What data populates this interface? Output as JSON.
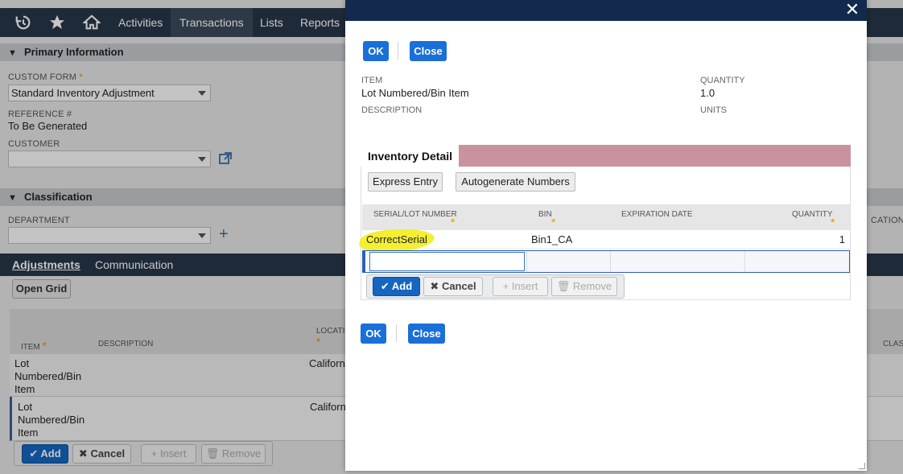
{
  "nav": {
    "items": [
      "Activities",
      "Transactions",
      "Lists",
      "Reports"
    ],
    "active": "Transactions"
  },
  "primary": {
    "title": "Primary Information",
    "custom_form_label": "CUSTOM FORM",
    "custom_form_value": "Standard Inventory Adjustment",
    "reference_label": "REFERENCE #",
    "reference_value": "To Be Generated",
    "customer_label": "CUSTOMER"
  },
  "classification": {
    "title": "Classification",
    "department_label": "DEPARTMENT",
    "right_label_fragment": "CATION"
  },
  "subtabs": [
    "Adjustments",
    "Communication"
  ],
  "bg_grid": {
    "open_grid_label": "Open Grid",
    "columns": [
      "ITEM",
      "DESCRIPTION",
      "LOCATI",
      "CLASS"
    ],
    "rows": [
      {
        "item": "Lot\nNumbered/Bin\nItem",
        "location": "Californi"
      },
      {
        "item": "Lot\nNumbered/Bin\nItem",
        "location": "Californ"
      }
    ],
    "buttons": {
      "add": "Add",
      "cancel": "Cancel",
      "insert": "Insert",
      "remove": "Remove"
    }
  },
  "modal": {
    "ok_label": "OK",
    "close_label": "Close",
    "item_label": "ITEM",
    "item_value": "Lot Numbered/Bin Item",
    "quantity_label": "QUANTITY",
    "quantity_value": "1.0",
    "description_label": "DESCRIPTION",
    "units_label": "UNITS",
    "tab_label": "Inventory Detail",
    "express_entry_label": "Express Entry",
    "autogenerate_label": "Autogenerate Numbers",
    "columns": {
      "serial": "SERIAL/LOT NUMBER",
      "bin": "BIN",
      "expiration": "EXPIRATION DATE",
      "quantity": "QUANTITY"
    },
    "row": {
      "serial": "CorrectSerial",
      "bin": "Bin1_CA",
      "expiration": "",
      "quantity": "1"
    },
    "edit_buttons": {
      "add": "Add",
      "cancel": "Cancel",
      "insert": "Insert",
      "remove": "Remove"
    },
    "colors": {
      "header": "#132a4e",
      "primary_button": "#1a6fd8",
      "tab_bar": "#c9929e",
      "highlight": "#f3ee28"
    }
  }
}
